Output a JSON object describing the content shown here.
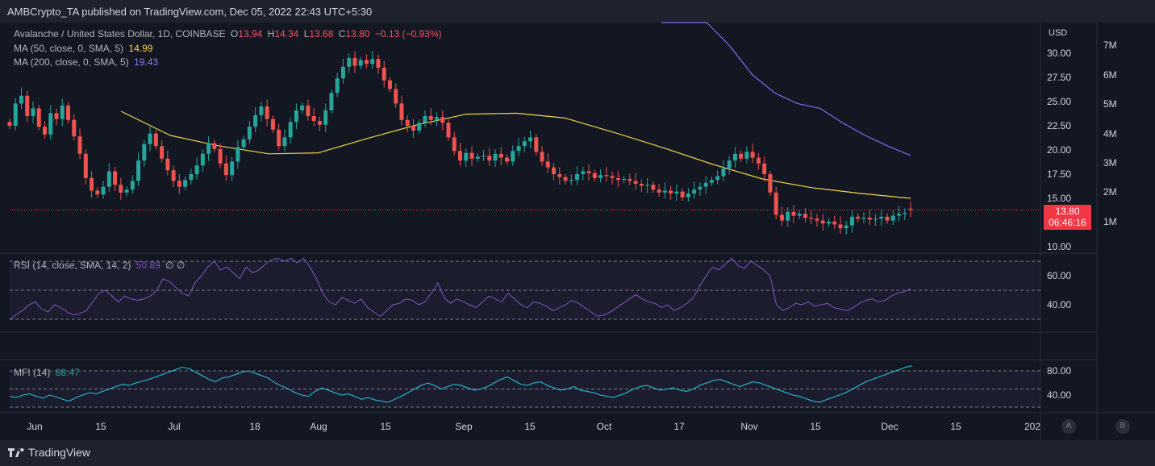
{
  "header": {
    "publish_line": "AMBCrypto_TA published on TradingView.com, Dec 05, 2022 22:43 UTC+5:30"
  },
  "legend": {
    "symbol": "Avalanche / United States Dollar, 1D, COINBASE",
    "o_label": "O",
    "o_value": "13.94",
    "h_label": "H",
    "h_value": "14.34",
    "l_label": "L",
    "l_value": "13.68",
    "c_label": "C",
    "c_value": "13.80",
    "change": "−0.13 (−0.93%)",
    "ma50_label": "MA (50, close, 0, SMA, 5)",
    "ma50_value": "14.99",
    "ma200_label": "MA (200, close, 0, SMA, 5)",
    "ma200_value": "19.43"
  },
  "rsi_legend": {
    "label": "RSI (14, close, SMA, 14, 2)",
    "value": "50.89",
    "extra": "∅ ∅"
  },
  "mfi_legend": {
    "label": "MFI (14)",
    "value": "88.47"
  },
  "price_label": {
    "value": "13.80",
    "countdown": "06:46:16"
  },
  "axis_buttons": {
    "a": "A",
    "b": "B"
  },
  "footer": {
    "brand": "TradingView"
  },
  "colors": {
    "background": "#131722",
    "up": "#26a69a",
    "down": "#ef5350",
    "ma50": "#f0d34b",
    "ma200": "#7b6cf0",
    "rsi": "#7e57c2",
    "mfi": "#26c6da"
  },
  "chart_data": [
    {
      "type": "candlestick",
      "title": "Avalanche / United States Dollar, 1D, COINBASE",
      "y_unit": "USD",
      "ylim": [
        9.5,
        32.0
      ],
      "price_ticks": [
        "30.00",
        "27.50",
        "25.00",
        "22.50",
        "20.00",
        "17.50",
        "15.00",
        "10.00"
      ],
      "volume_ticks": [
        "7M",
        "6M",
        "5M",
        "4M",
        "3M",
        "2M",
        "1M"
      ],
      "x_tick_labels": [
        "Jun",
        "15",
        "Jul",
        "18",
        "Aug",
        "15",
        "Sep",
        "15",
        "Oct",
        "17",
        "Nov",
        "15",
        "Dec",
        "15",
        "202"
      ],
      "closes": [
        22.5,
        24.8,
        25.6,
        23.5,
        24.3,
        22.4,
        21.6,
        23.8,
        23.2,
        24.6,
        23.1,
        21.4,
        19.6,
        17.1,
        15.8,
        15.4,
        16.2,
        17.8,
        16.4,
        15.6,
        15.9,
        16.8,
        18.9,
        20.6,
        21.7,
        20.4,
        19.1,
        17.9,
        16.8,
        16.2,
        16.9,
        17.5,
        18.4,
        19.6,
        20.7,
        20.1,
        18.6,
        17.4,
        18.8,
        20.3,
        21.1,
        22.4,
        23.6,
        24.5,
        23.2,
        22.1,
        20.4,
        21.3,
        22.9,
        24.1,
        24.6,
        23.5,
        23.0,
        22.6,
        24.1,
        25.9,
        27.4,
        28.6,
        29.5,
        28.7,
        29.3,
        28.9,
        29.4,
        28.5,
        27.2,
        26.3,
        24.8,
        23.1,
        22.5,
        22.0,
        22.8,
        23.5,
        23.1,
        23.4,
        22.8,
        21.3,
        19.9,
        18.9,
        19.7,
        19.1,
        19.3,
        19.4,
        18.9,
        19.6,
        19.2,
        18.8,
        19.9,
        20.4,
        20.9,
        21.3,
        19.8,
        18.8,
        18.2,
        17.5,
        17.2,
        16.8,
        16.9,
        17.5,
        17.8,
        17.6,
        17.1,
        17.4,
        17.3,
        17.1,
        16.9,
        17.0,
        16.8,
        16.5,
        16.3,
        16.4,
        15.9,
        15.6,
        15.8,
        15.5,
        15.7,
        15.1,
        15.5,
        15.9,
        16.2,
        16.6,
        16.9,
        17.3,
        18.1,
        18.9,
        19.6,
        19.1,
        19.8,
        19.2,
        18.6,
        17.5,
        15.6,
        13.3,
        12.7,
        13.6,
        13.2,
        13.4,
        13.0,
        12.9,
        12.7,
        12.4,
        12.6,
        12.3,
        11.9,
        12.2,
        13.1,
        12.9,
        13.0,
        12.8,
        12.9,
        13.1,
        12.7,
        13.2,
        13.4,
        13.5,
        13.8
      ],
      "ma50": [
        24.0,
        21.5,
        20.4,
        19.6,
        19.7,
        21.2,
        22.6,
        23.7,
        23.8,
        23.3,
        21.8,
        20.2,
        18.5,
        17.0,
        16.1,
        15.5,
        15.0
      ],
      "ma200": [
        46.5,
        38.0,
        33.8,
        30.8,
        27.8,
        25.9,
        24.8,
        24.3,
        22.8,
        21.5,
        20.4,
        19.43
      ],
      "current_close": 13.8,
      "current_ma50": 14.99,
      "current_ma200": 19.43
    },
    {
      "type": "line",
      "title": "RSI (14, close, SMA, 14, 2)",
      "y_ticks": [
        "60.00",
        "40.00"
      ],
      "ylim": [
        25,
        78
      ],
      "bands": [
        70,
        50,
        30
      ],
      "values": [
        30,
        33,
        36,
        40,
        42,
        37,
        35,
        40,
        38,
        35,
        33,
        34,
        36,
        42,
        48,
        50,
        46,
        42,
        46,
        44,
        43,
        44,
        46,
        50,
        58,
        56,
        52,
        48,
        46,
        55,
        60,
        66,
        70,
        64,
        66,
        62,
        58,
        66,
        62,
        64,
        68,
        71,
        72,
        70,
        72,
        69,
        72,
        66,
        58,
        48,
        42,
        40,
        45,
        43,
        41,
        44,
        38,
        35,
        32,
        36,
        40,
        41,
        44,
        43,
        40,
        42,
        48,
        55,
        45,
        41,
        44,
        42,
        40,
        38,
        42,
        46,
        44,
        42,
        48,
        44,
        40,
        38,
        42,
        41,
        39,
        36,
        38,
        40,
        43,
        41,
        38,
        35,
        32,
        33,
        35,
        38,
        41,
        44,
        47,
        44,
        42,
        41,
        38,
        40,
        36,
        38,
        41,
        45,
        53,
        60,
        66,
        64,
        68,
        72,
        67,
        65,
        70,
        67,
        64,
        60,
        40,
        36,
        38,
        41,
        40,
        42,
        39,
        40,
        41,
        38,
        37,
        36,
        38,
        41,
        43,
        44,
        42,
        43,
        46,
        48,
        49,
        51
      ],
      "last_value": 50.89
    },
    {
      "type": "line",
      "title": "MFI (14)",
      "y_ticks": [
        "80.00",
        "40.00"
      ],
      "ylim": [
        22,
        92
      ],
      "bands": [
        80,
        50,
        20
      ],
      "values": [
        38,
        36,
        40,
        42,
        38,
        35,
        40,
        37,
        33,
        30,
        36,
        40,
        44,
        42,
        46,
        50,
        54,
        58,
        56,
        60,
        63,
        66,
        70,
        74,
        78,
        82,
        86,
        84,
        78,
        72,
        66,
        62,
        68,
        70,
        74,
        78,
        80,
        76,
        72,
        68,
        60,
        55,
        50,
        44,
        40,
        38,
        46,
        52,
        48,
        44,
        40,
        42,
        38,
        33,
        36,
        32,
        30,
        28,
        33,
        38,
        44,
        50,
        56,
        60,
        56,
        50,
        54,
        58,
        56,
        52,
        48,
        50,
        54,
        60,
        66,
        70,
        64,
        58,
        56,
        60,
        62,
        56,
        52,
        48,
        50,
        54,
        48,
        46,
        44,
        40,
        38,
        36,
        40,
        44,
        50,
        54,
        56,
        52,
        48,
        50,
        52,
        48,
        46,
        50,
        56,
        60,
        64,
        66,
        62,
        58,
        54,
        58,
        62,
        60,
        56,
        52,
        48,
        44,
        40,
        38,
        34,
        30,
        28,
        32,
        36,
        40,
        44,
        50,
        56,
        62,
        66,
        70,
        74,
        78,
        82,
        86,
        88.5
      ],
      "last_value": 88.47
    }
  ]
}
